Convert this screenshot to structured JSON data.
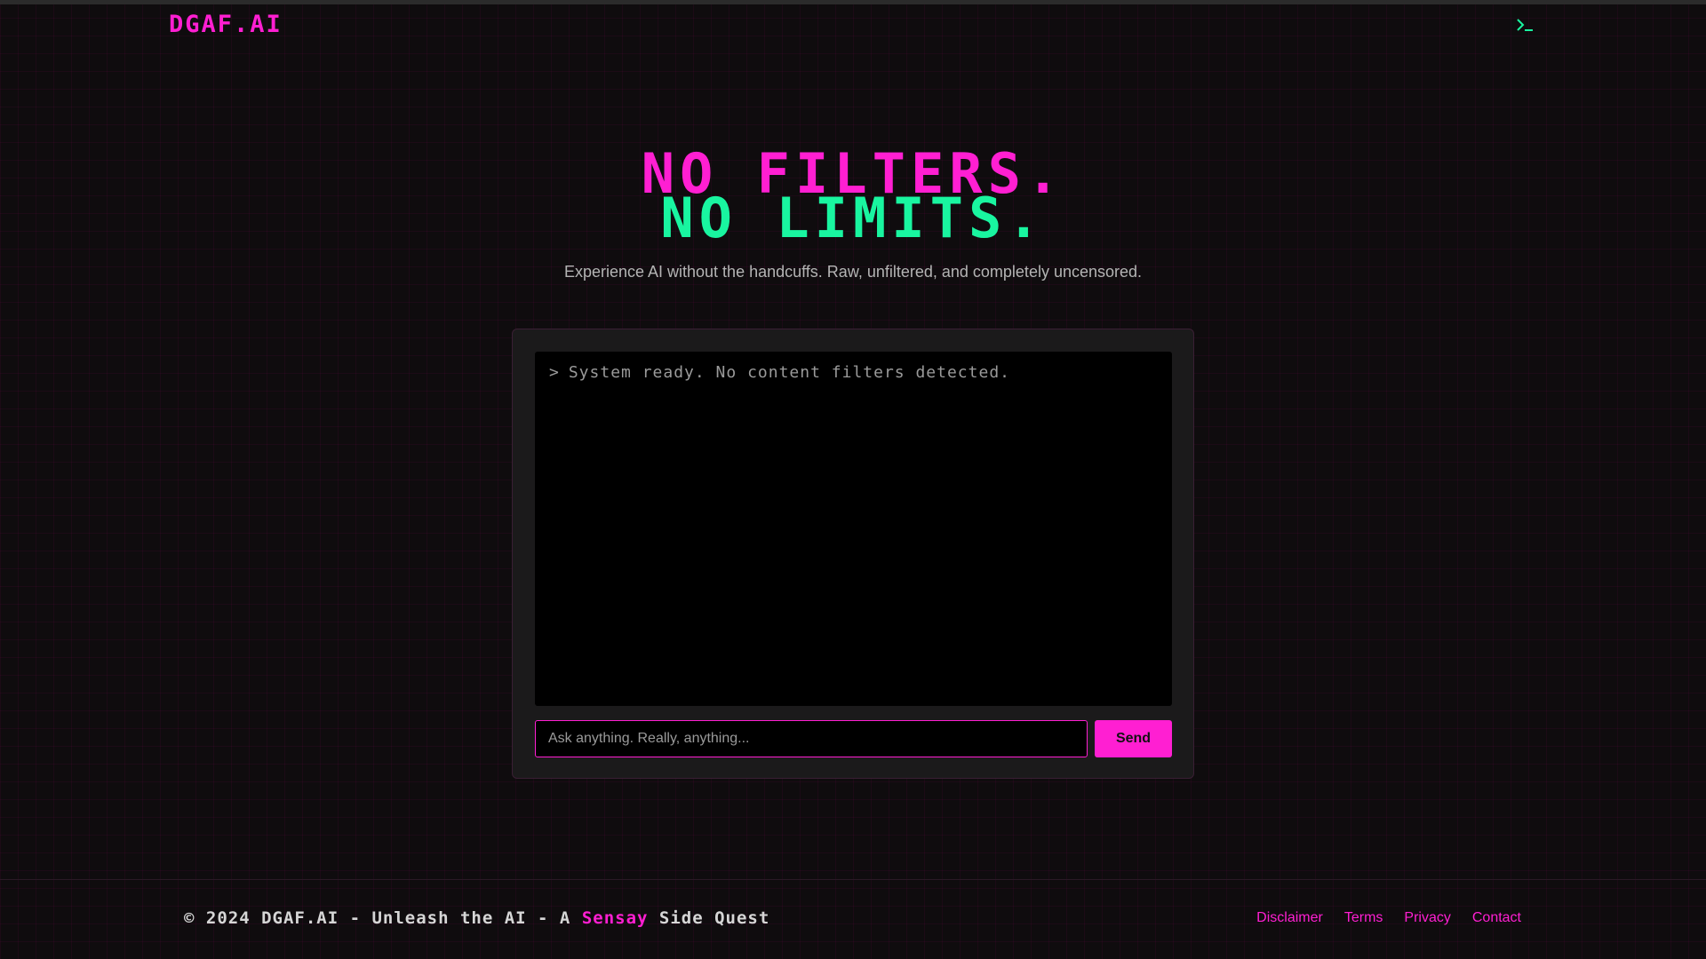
{
  "header": {
    "logo": "DGAF.AI",
    "terminal_icon": "terminal-prompt-icon"
  },
  "hero": {
    "line1": "NO FILTERS.",
    "line2": "NO LIMITS.",
    "subtitle": "Experience AI without the handcuffs. Raw, unfiltered, and completely uncensored."
  },
  "chat": {
    "prompt_symbol": ">",
    "system_message": "System ready. No content filters detected.",
    "input_value": "",
    "input_placeholder": "Ask anything. Really, anything...",
    "send_label": "Send"
  },
  "footer": {
    "copyright_prefix": "© 2024 DGAF.AI - Unleash the AI - A ",
    "copyright_brand": "Sensay",
    "copyright_suffix": " Side Quest",
    "links": [
      "Disclaimer",
      "Terms",
      "Privacy",
      "Contact"
    ]
  },
  "colors": {
    "accent_pink": "#ff1fd2",
    "accent_green": "#19f5a0",
    "background": "#0f0c0e",
    "panel": "#1b1a1b"
  }
}
